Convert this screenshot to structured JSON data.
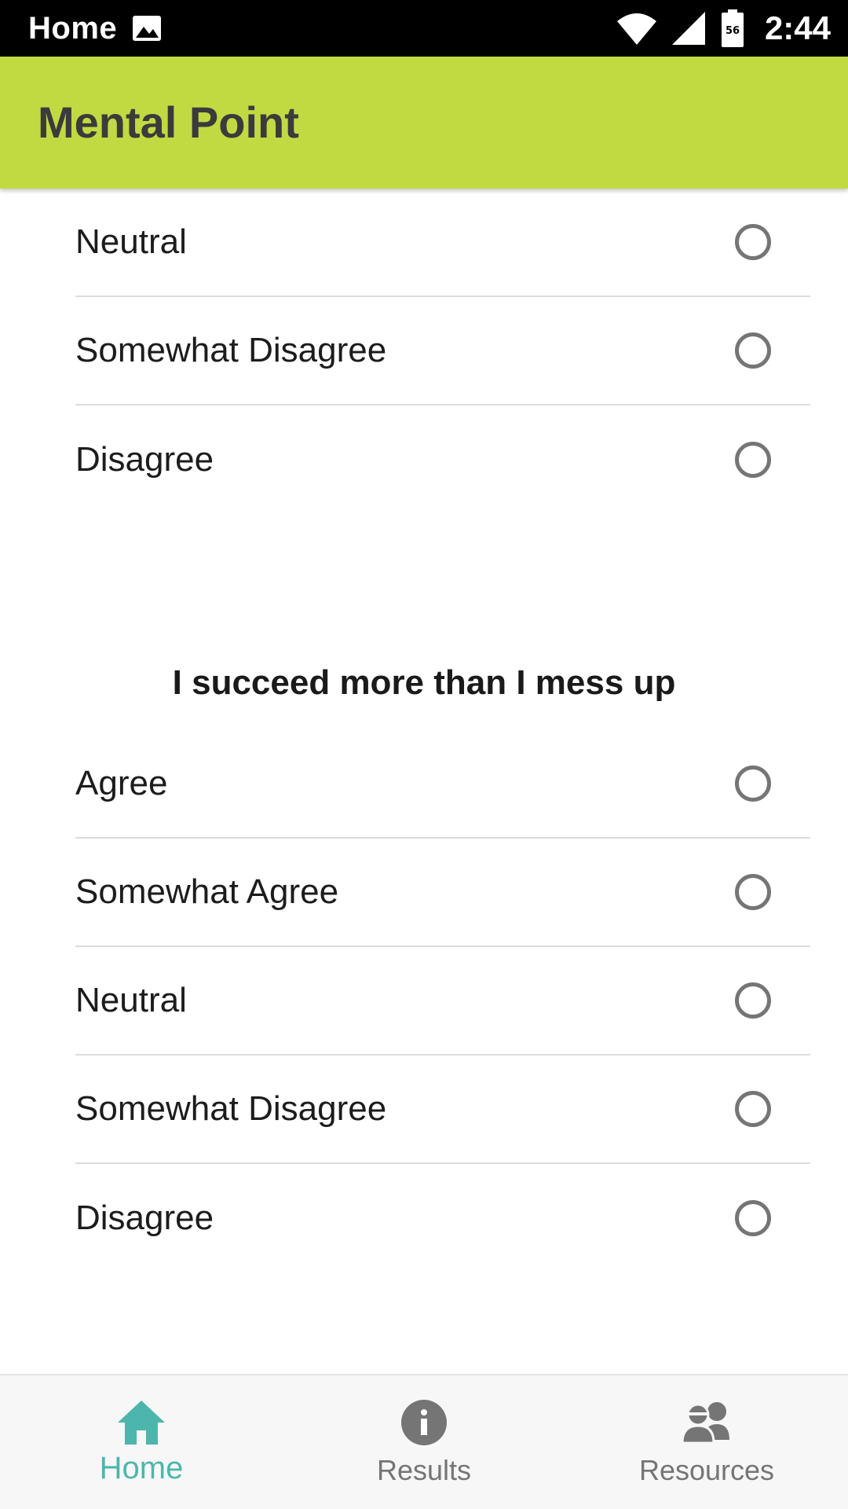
{
  "status_bar": {
    "app_name": "Home",
    "time": "2:44",
    "battery_level": "56",
    "icons": [
      "image-icon",
      "wifi-icon",
      "cell-signal-icon",
      "battery-icon"
    ]
  },
  "app_bar": {
    "title": "Mental Point",
    "color": "#c1da42"
  },
  "questions": [
    {
      "question": "",
      "options": [
        "Neutral",
        "Somewhat Disagree",
        "Disagree"
      ]
    },
    {
      "question": "I succeed more than I mess up",
      "options": [
        "Agree",
        "Somewhat Agree",
        "Neutral",
        "Somewhat Disagree",
        "Disagree"
      ]
    }
  ],
  "bottom_nav": {
    "items": [
      {
        "label": "Home",
        "icon": "home-icon",
        "active": true
      },
      {
        "label": "Results",
        "icon": "info-icon",
        "active": false
      },
      {
        "label": "Resources",
        "icon": "people-icon",
        "active": false
      }
    ],
    "active_color": "#4db6ac",
    "inactive_color": "#757575"
  }
}
